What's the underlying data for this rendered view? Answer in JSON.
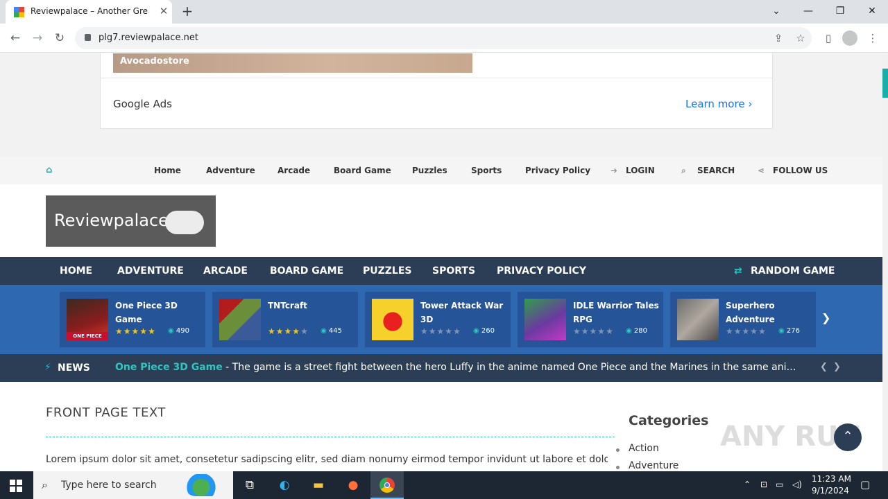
{
  "browser": {
    "tab_title": "Reviewpalace – Another Great O",
    "tab_close": "✕",
    "new_tab": "+",
    "url": "plg7.reviewpalace.net",
    "controls": {
      "dropdown": "⌄",
      "minimize": "—",
      "restore": "❐",
      "close": "✕"
    },
    "nav": {
      "back": "←",
      "forward": "→",
      "reload": "↻"
    }
  },
  "ad": {
    "image_label": "Avocadostore",
    "brand": "Google Ads",
    "learn_more": "Learn more  ›"
  },
  "top_menu": {
    "items": [
      "Home",
      "Adventure",
      "Arcade",
      "Board Game",
      "Puzzles",
      "Sports",
      "Privacy Policy"
    ],
    "login": "LOGIN",
    "search": "SEARCH",
    "follow": "FOLLOW US"
  },
  "logo": {
    "text": "Reviewpalace"
  },
  "main_nav": {
    "items": [
      "HOME",
      "ADVENTURE",
      "ARCADE",
      "BOARD GAME",
      "PUZZLES",
      "SPORTS",
      "PRIVACY POLICY"
    ],
    "random": "RANDOM GAME"
  },
  "games": [
    {
      "title": "One Piece 3D Game",
      "rating": 5,
      "views": "490",
      "thumb_label": "ONE PIECE"
    },
    {
      "title": "TNTcraft",
      "rating": 4,
      "views": "445"
    },
    {
      "title": "Tower Attack War 3D",
      "rating": 0,
      "views": "260"
    },
    {
      "title": "IDLE Warrior Tales RPG",
      "rating": 0,
      "views": "280"
    },
    {
      "title": "Superhero Adventure",
      "rating": 0,
      "views": "276"
    }
  ],
  "news": {
    "label": "NEWS",
    "headline": "One Piece 3D Game",
    "text": " - The game is a street fight between the hero Luffy in the anime named One Piece and the Marines in the same anime, whe..."
  },
  "content": {
    "title": "FRONT PAGE TEXT",
    "body": "Lorem ipsum dolor sit amet, consetetur sadipscing elitr, sed diam nonumy eirmod tempor invidunt ut labore et dolore"
  },
  "sidebar": {
    "title": "Categories",
    "items": [
      "Action",
      "Adventure"
    ]
  },
  "watermark": "ANY RUN",
  "taskbar": {
    "search_placeholder": "Type here to search",
    "time": "11:23 AM",
    "date": "9/1/2024"
  },
  "colors": {
    "accent": "#2ec7c0",
    "nav": "#2c3e56",
    "carousel": "#2d68b0",
    "star_on": "#f5c518",
    "star_off": "#7f95b5"
  }
}
